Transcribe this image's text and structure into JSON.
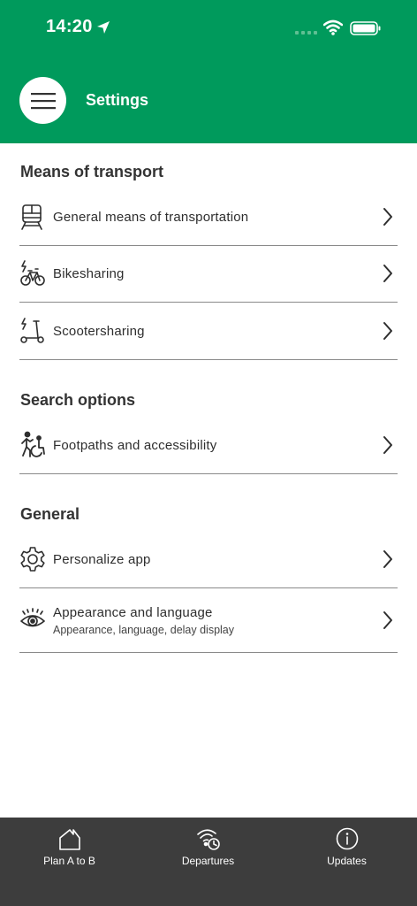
{
  "status_bar": {
    "time": "14:20"
  },
  "header": {
    "title": "Settings"
  },
  "sections": [
    {
      "title": "Means of transport",
      "items": [
        {
          "label": "General means of transportation",
          "icon": "train-icon"
        },
        {
          "label": "Bikesharing",
          "icon": "bikesharing-icon"
        },
        {
          "label": "Scootersharing",
          "icon": "scootersharing-icon"
        }
      ]
    },
    {
      "title": "Search options",
      "items": [
        {
          "label": "Footpaths and accessibility",
          "icon": "accessibility-icon"
        }
      ]
    },
    {
      "title": "General",
      "items": [
        {
          "label": "Personalize app",
          "icon": "gear-icon"
        },
        {
          "label": "Appearance and language",
          "sublabel": "Appearance, language, delay display",
          "icon": "eye-icon"
        }
      ]
    }
  ],
  "tabbar": {
    "tabs": [
      {
        "label": "Plan A to B",
        "icon": "home-icon"
      },
      {
        "label": "Departures",
        "icon": "departures-icon"
      },
      {
        "label": "Updates",
        "icon": "info-icon"
      }
    ]
  },
  "colors": {
    "brand": "#009a5c",
    "tabbar": "#3d3d3d",
    "divider": "#8a8a8a"
  }
}
